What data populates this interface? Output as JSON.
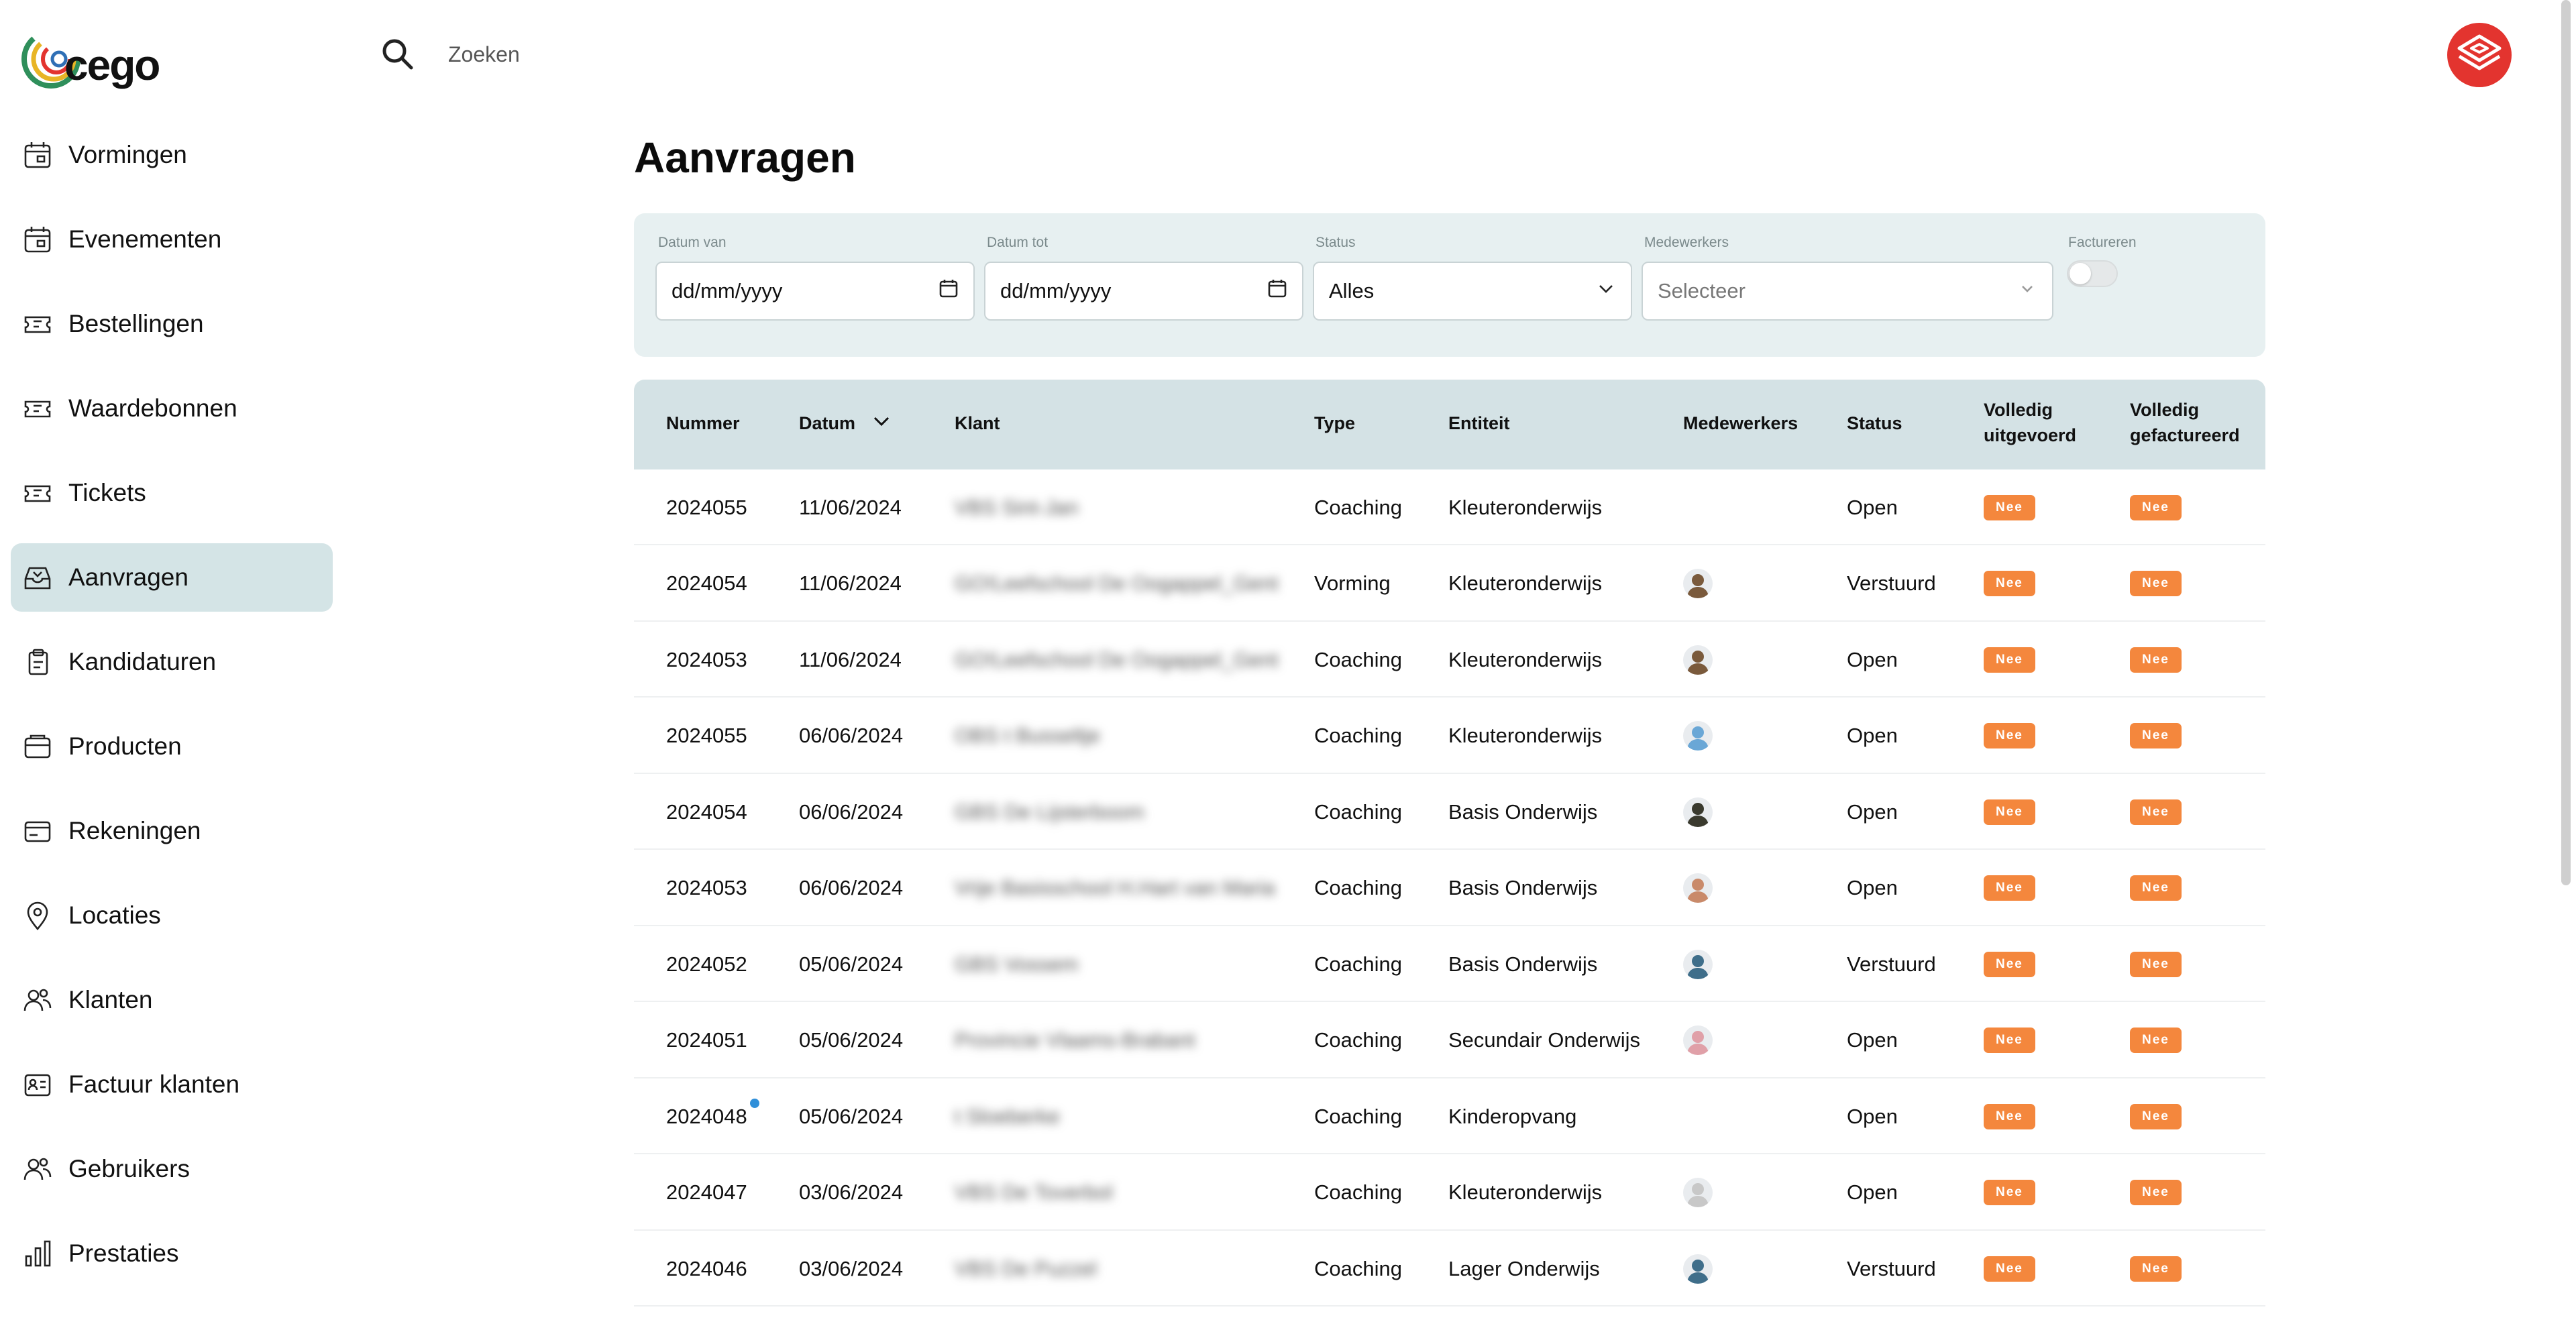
{
  "brand": {
    "name": "cego"
  },
  "search": {
    "placeholder": "Zoeken"
  },
  "sidebar": {
    "items": [
      {
        "label": "Vormingen",
        "icon": "calendar-icon",
        "active": false
      },
      {
        "label": "Evenementen",
        "icon": "calendar-icon",
        "active": false
      },
      {
        "label": "Bestellingen",
        "icon": "ticket-icon",
        "active": false
      },
      {
        "label": "Waardebonnen",
        "icon": "ticket-icon",
        "active": false
      },
      {
        "label": "Tickets",
        "icon": "ticket-icon",
        "active": false
      },
      {
        "label": "Aanvragen",
        "icon": "inbox-icon",
        "active": true
      },
      {
        "label": "Kandidaturen",
        "icon": "clipboard-icon",
        "active": false
      },
      {
        "label": "Producten",
        "icon": "box-icon",
        "active": false
      },
      {
        "label": "Rekeningen",
        "icon": "credit-card-icon",
        "active": false
      },
      {
        "label": "Locaties",
        "icon": "map-pin-icon",
        "active": false
      },
      {
        "label": "Klanten",
        "icon": "users-icon",
        "active": false
      },
      {
        "label": "Factuur klanten",
        "icon": "id-card-icon",
        "active": false
      },
      {
        "label": "Gebruikers",
        "icon": "users-icon",
        "active": false
      },
      {
        "label": "Prestaties",
        "icon": "bar-chart-icon",
        "active": false
      }
    ]
  },
  "page": {
    "title": "Aanvragen"
  },
  "filters": {
    "date_from": {
      "label": "Datum van",
      "value": "dd/mm/yyyy"
    },
    "date_to": {
      "label": "Datum tot",
      "value": "dd/mm/yyyy"
    },
    "status": {
      "label": "Status",
      "value": "Alles"
    },
    "employees": {
      "label": "Medewerkers",
      "placeholder": "Selecteer"
    },
    "invoice": {
      "label": "Factureren",
      "on": false
    }
  },
  "table": {
    "headers": {
      "number": "Nummer",
      "date": "Datum",
      "client": "Klant",
      "type": "Type",
      "entity": "Entiteit",
      "employees": "Medewerkers",
      "status": "Status",
      "executed_1": "Volledig",
      "executed_2": "uitgevoerd",
      "invoiced_1": "Volledig",
      "invoiced_2": "gefactureerd"
    },
    "rows": [
      {
        "number": "2024055",
        "date": "11/06/2024",
        "client": "VBS Sint-Jan",
        "type": "Coaching",
        "entity": "Kleuteronderwijs",
        "avatar": "",
        "status": "Open",
        "executed": "Nee",
        "invoiced": "Nee"
      },
      {
        "number": "2024054",
        "date": "11/06/2024",
        "client": "GO!Leefschool De Oogappel_Gent",
        "type": "Vorming",
        "entity": "Kleuteronderwijs",
        "avatar": "#7a5a3c",
        "status": "Verstuurd",
        "executed": "Nee",
        "invoiced": "Nee"
      },
      {
        "number": "2024053",
        "date": "11/06/2024",
        "client": "GO!Leefschool De Oogappel_Gent",
        "type": "Coaching",
        "entity": "Kleuteronderwijs",
        "avatar": "#7a5a3c",
        "status": "Open",
        "executed": "Nee",
        "invoiced": "Nee"
      },
      {
        "number": "2024055",
        "date": "06/06/2024",
        "client": "OBS t Busseltje",
        "type": "Coaching",
        "entity": "Kleuteronderwijs",
        "avatar": "#6aa7d6",
        "status": "Open",
        "executed": "Nee",
        "invoiced": "Nee"
      },
      {
        "number": "2024054",
        "date": "06/06/2024",
        "client": "GBS De Lijsterboom",
        "type": "Coaching",
        "entity": "Basis Onderwijs",
        "avatar": "#3a3a2e",
        "status": "Open",
        "executed": "Nee",
        "invoiced": "Nee"
      },
      {
        "number": "2024053",
        "date": "06/06/2024",
        "client": "Vrije Basisschool H.Hart van Maria",
        "type": "Coaching",
        "entity": "Basis Onderwijs",
        "avatar": "#c98a6a",
        "status": "Open",
        "executed": "Nee",
        "invoiced": "Nee"
      },
      {
        "number": "2024052",
        "date": "05/06/2024",
        "client": "GBS Vossem",
        "type": "Coaching",
        "entity": "Basis Onderwijs",
        "avatar": "#3f6e8a",
        "status": "Verstuurd",
        "executed": "Nee",
        "invoiced": "Nee"
      },
      {
        "number": "2024051",
        "date": "05/06/2024",
        "client": "Provincie Vlaams-Brabant",
        "type": "Coaching",
        "entity": "Secundair Onderwijs",
        "avatar": "#e0a0a8",
        "status": "Open",
        "executed": "Nee",
        "invoiced": "Nee"
      },
      {
        "number": "2024048",
        "date": "05/06/2024",
        "client": "t Sloeberke",
        "type": "Coaching",
        "entity": "Kinderopvang",
        "avatar": "",
        "status": "Open",
        "executed": "Nee",
        "invoiced": "Nee"
      },
      {
        "number": "2024047",
        "date": "03/06/2024",
        "client": "VBS De Toverbol",
        "type": "Coaching",
        "entity": "Kleuteronderwijs",
        "avatar": "#c8c8c8",
        "status": "Open",
        "executed": "Nee",
        "invoiced": "Nee"
      },
      {
        "number": "2024046",
        "date": "03/06/2024",
        "client": "VBS De Puzzel",
        "type": "Coaching",
        "entity": "Lager Onderwijs",
        "avatar": "#3f6e8a",
        "status": "Verstuurd",
        "executed": "Nee",
        "invoiced": "Nee"
      }
    ]
  },
  "colors": {
    "accent": "#f4873d",
    "active_nav": "#d4e4e6",
    "filter_bg": "#e7f0f1",
    "table_header": "#d4e2e5",
    "brand_red": "#e3342f"
  }
}
